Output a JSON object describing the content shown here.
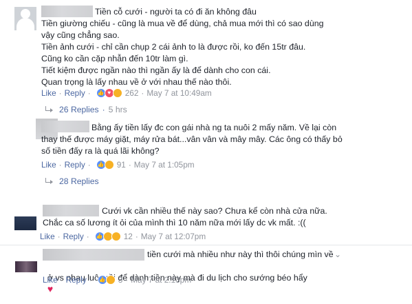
{
  "comments": [
    {
      "lines": [
        "Tiền cỗ cưới - người ta có đi ăn không đâu",
        "Tiền giường chiếu - cũng là mua về để dùng, chả mua mới thì có sao dùng",
        "vậy cũng chẳng sao.",
        "Tiền ảnh cưới - chỉ cần chụp 2 cái ảnh to là được rồi, ko đến 15tr đâu.",
        "Cũng ko cần cặp nhẫn đến 10tr làm gì.",
        "Tiết kiệm được ngần nào thì ngần ấy là để dành cho con cái.",
        "Quan trọng là lấy nhau về ở với nhau thế nào thôi."
      ],
      "like": "Like",
      "reply": "Reply",
      "reactions": "262",
      "time": "May 7 at 10:49am",
      "replies": "26 Replies",
      "replies_time": "5 hrs"
    },
    {
      "lines": [
        "Bằng ấy tiền lấy đc con gái nhà ng ta nuôi 2 mấy năm. Về lại còn",
        "thay thế được máy giặt, máy rửa bát...vân vân và mây mây. Các ông có thấy bỏ",
        "số tiền đấy ra là quá lãi không?"
      ],
      "like": "Like",
      "reply": "Reply",
      "reactions": "91",
      "time": "May 7 at 1:05pm",
      "replies": "28 Replies"
    },
    {
      "lines": [
        "Cưới vk cần nhiều thế này sao? Chưa kể còn nhà cửa nữa.",
        "Chắc ca số lương ít ỏi của mình thì 10 năm nữa mới lấy dc vk mất. :(("
      ],
      "like": "Like",
      "reply": "Reply",
      "reactions": "12",
      "time": "May 7 at 12:07pm"
    },
    {
      "lines": [
        "tiền cưới mà nhiều như này thì thôi chúng mìn về",
        "ở vs nhau luôn rồi để dành tiền này mà đi du lịch cho sướng béo hẩy"
      ],
      "like": "Like",
      "reply": "Reply",
      "reactions": "3",
      "time": "May 7 at 2:13pm"
    }
  ],
  "separator": "·",
  "icons": {
    "close": "close-icon",
    "heart": "heart-icon",
    "reply_arrow": "reply-arrow-icon"
  },
  "colors": {
    "link": "#4b67a1",
    "meta": "#90949c",
    "text": "#1d2129"
  }
}
